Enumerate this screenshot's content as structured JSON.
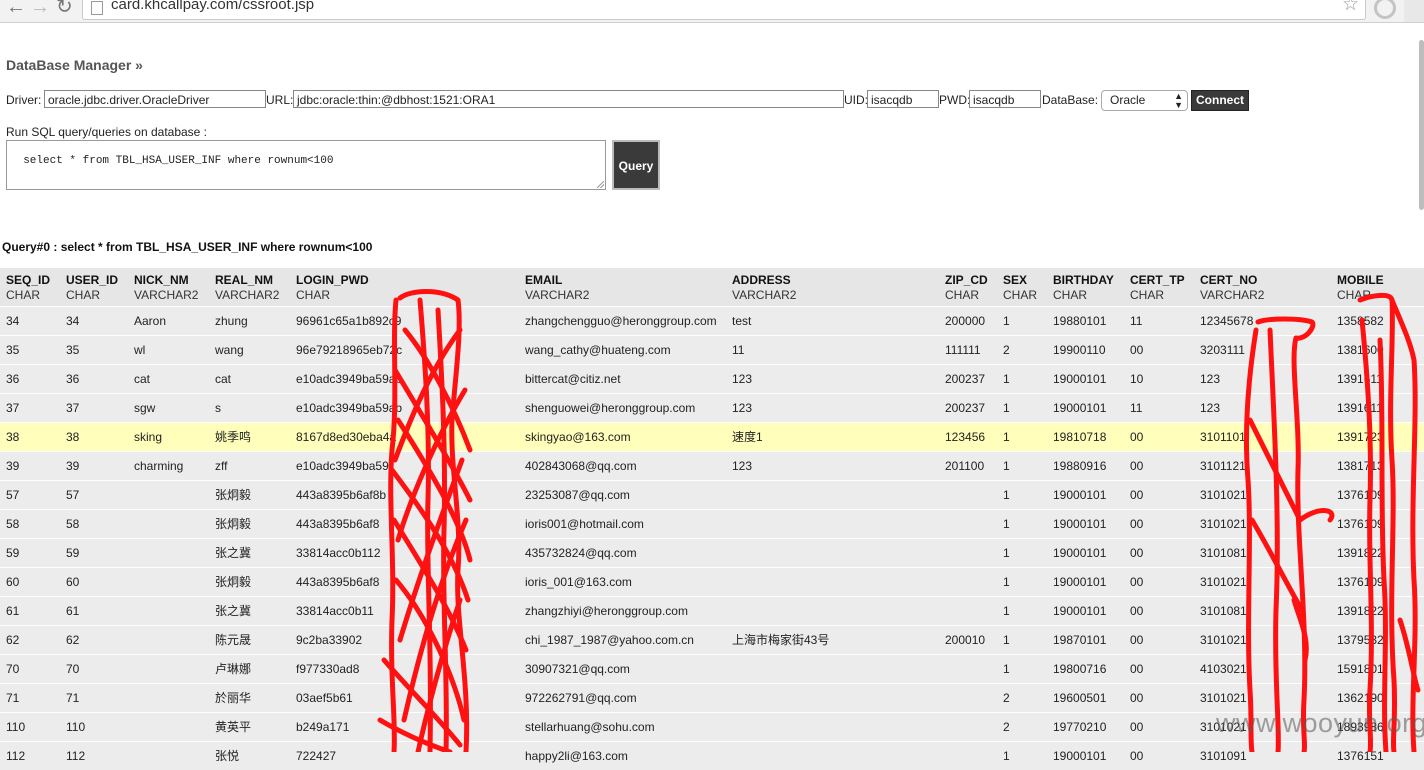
{
  "browser": {
    "url": "card.khcallpay.com/cssroot.jsp",
    "back_glyph": "←",
    "forward_glyph": "→",
    "reload_glyph": "↻",
    "star_glyph": "☆"
  },
  "page": {
    "title": "DataBase Manager »",
    "driver_label": "Driver:",
    "driver_value": "oracle.jdbc.driver.OracleDriver",
    "url_label": "URL:",
    "url_value": "jdbc:oracle:thin:@dbhost:1521:ORA1",
    "uid_label": "UID:",
    "uid_value": "isacqdb",
    "pwd_label": "PWD:",
    "pwd_value": "isacqdb",
    "database_label": "DataBase:",
    "database_value": "Oracle",
    "connect_label": "Connect",
    "sql_label": "Run SQL query/queries on database :",
    "sql_value": "select * from TBL_HSA_USER_INF where rownum<100",
    "query_label": "Query",
    "query_heading": "Query#0 : select * from TBL_HSA_USER_INF where rownum<100"
  },
  "table": {
    "columns": [
      {
        "name": "SEQ_ID",
        "type": "CHAR"
      },
      {
        "name": "USER_ID",
        "type": "CHAR"
      },
      {
        "name": "NICK_NM",
        "type": "VARCHAR2"
      },
      {
        "name": "REAL_NM",
        "type": "VARCHAR2"
      },
      {
        "name": "LOGIN_PWD",
        "type": "CHAR"
      },
      {
        "name": "EMAIL",
        "type": "VARCHAR2"
      },
      {
        "name": "ADDRESS",
        "type": "VARCHAR2"
      },
      {
        "name": "ZIP_CD",
        "type": "CHAR"
      },
      {
        "name": "SEX",
        "type": "CHAR"
      },
      {
        "name": "BIRTHDAY",
        "type": "CHAR"
      },
      {
        "name": "CERT_TP",
        "type": "CHAR"
      },
      {
        "name": "CERT_NO",
        "type": "VARCHAR2"
      },
      {
        "name": "MOBILE",
        "type": "CHAR"
      }
    ],
    "rows": [
      [
        "34",
        "34",
        "Aaron",
        "zhung",
        "96961c65a1b892c9",
        "zhangchengguo@heronggroup.com",
        "test",
        "200000",
        "1",
        "19880101",
        "11",
        "12345678",
        "1358582"
      ],
      [
        "35",
        "35",
        "wl",
        "wang",
        "96e79218965eb72c",
        "wang_cathy@huateng.com",
        "11",
        "111111",
        "2",
        "19900110",
        "00",
        "3203111",
        "1381600"
      ],
      [
        "36",
        "36",
        "cat",
        "cat",
        "e10adc3949ba59ab",
        "bittercat@citiz.net",
        "123",
        "200237",
        "1",
        "19000101",
        "10",
        "123",
        "1391611"
      ],
      [
        "37",
        "37",
        "sgw",
        "s",
        "e10adc3949ba59ab",
        "shenguowei@heronggroup.com",
        "123",
        "200237",
        "1",
        "19000101",
        "11",
        "123",
        "1391611"
      ],
      [
        "38",
        "38",
        "sking",
        "姚季鸣",
        "8167d8ed30eba4a",
        "skingyao@163.com",
        "速度1",
        "123456",
        "1",
        "19810718",
        "00",
        "3101101",
        "1391723"
      ],
      [
        "39",
        "39",
        "charming",
        "zff",
        "e10adc3949ba59",
        "402843068@qq.com",
        "123",
        "201100",
        "1",
        "19880916",
        "00",
        "3101121",
        "1381713"
      ],
      [
        "57",
        "57",
        "",
        "张炯毅",
        "443a8395b6af8b",
        "23253087@qq.com",
        "",
        "",
        "1",
        "19000101",
        "00",
        "3101021",
        "1376109"
      ],
      [
        "58",
        "58",
        "",
        "张炯毅",
        "443a8395b6af8",
        "ioris001@hotmail.com",
        "",
        "",
        "1",
        "19000101",
        "00",
        "3101021",
        "1376109"
      ],
      [
        "59",
        "59",
        "",
        "张之冀",
        "33814acc0b112",
        "435732824@qq.com",
        "",
        "",
        "1",
        "19000101",
        "00",
        "3101081",
        "1391822"
      ],
      [
        "60",
        "60",
        "",
        "张炯毅",
        "443a8395b6af8",
        "ioris_001@163.com",
        "",
        "",
        "1",
        "19000101",
        "00",
        "3101021",
        "1376109"
      ],
      [
        "61",
        "61",
        "",
        "张之冀",
        "33814acc0b11",
        "zhangzhiyi@heronggroup.com",
        "",
        "",
        "1",
        "19000101",
        "00",
        "3101081",
        "1391822"
      ],
      [
        "62",
        "62",
        "",
        "陈元晟",
        "9c2ba33902",
        "chi_1987_1987@yahoo.com.cn",
        "上海市梅家街43号",
        "200010",
        "1",
        "19870101",
        "00",
        "3101021",
        "1379532"
      ],
      [
        "70",
        "70",
        "",
        "卢琳娜",
        "f977330ad8",
        "30907321@qq.com",
        "",
        "",
        "1",
        "19800716",
        "00",
        "4103021",
        "1591801"
      ],
      [
        "71",
        "71",
        "",
        "於丽华",
        "03aef5b61",
        "972262791@qq.com",
        "",
        "",
        "2",
        "19600501",
        "00",
        "3101021",
        "1362190"
      ],
      [
        "110",
        "110",
        "",
        "黄英平",
        "b249a171",
        "stellarhuang@sohu.com",
        "",
        "",
        "2",
        "19770210",
        "00",
        "3101021",
        "1893986"
      ],
      [
        "112",
        "112",
        "",
        "张悦",
        "722427",
        "happy2li@163.com",
        "",
        "",
        "1",
        "19000101",
        "00",
        "3101091",
        "1376151"
      ]
    ],
    "highlighted_row": 4
  },
  "watermark": "www.wooyun.org",
  "colors": {
    "header_bg": "#e6e6e6",
    "row_bg": "#ececec",
    "highlight_bg": "#ffffbb",
    "scribble": "#ff0000",
    "button_dark": "#3a3a3a"
  }
}
